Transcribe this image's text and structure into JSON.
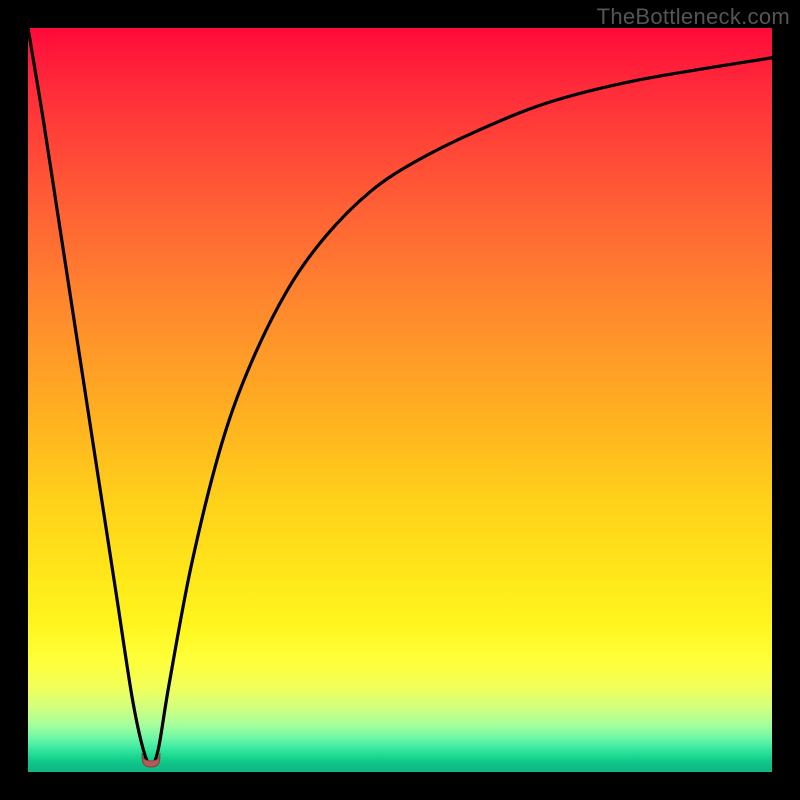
{
  "watermark": "TheBottleneck.com",
  "colors": {
    "frame": "#000000",
    "curve": "#000000",
    "marker": "#b85a58",
    "watermark_text": "#555555"
  },
  "chart_data": {
    "type": "line",
    "title": "",
    "xlabel": "",
    "ylabel": "",
    "xlim": [
      0,
      100
    ],
    "ylim": [
      0,
      100
    ],
    "x": [
      0,
      2,
      4,
      6,
      8,
      10,
      12,
      14,
      15.5,
      16.5,
      17.5,
      19,
      22,
      26,
      30,
      35,
      40,
      46,
      52,
      60,
      70,
      82,
      100
    ],
    "y": [
      100,
      88,
      75,
      62,
      49,
      36,
      23,
      10,
      3,
      1,
      3,
      12,
      28,
      44,
      55,
      65,
      72,
      78,
      82,
      86,
      90,
      93,
      96
    ],
    "minimum": {
      "x": 16.5,
      "y": 1
    },
    "background_gradient_stops": [
      {
        "pos": 0.0,
        "color": "#ff0a3a"
      },
      {
        "pos": 0.5,
        "color": "#ffc81c"
      },
      {
        "pos": 0.85,
        "color": "#ffff3a"
      },
      {
        "pos": 1.0,
        "color": "#0fb884"
      }
    ]
  }
}
